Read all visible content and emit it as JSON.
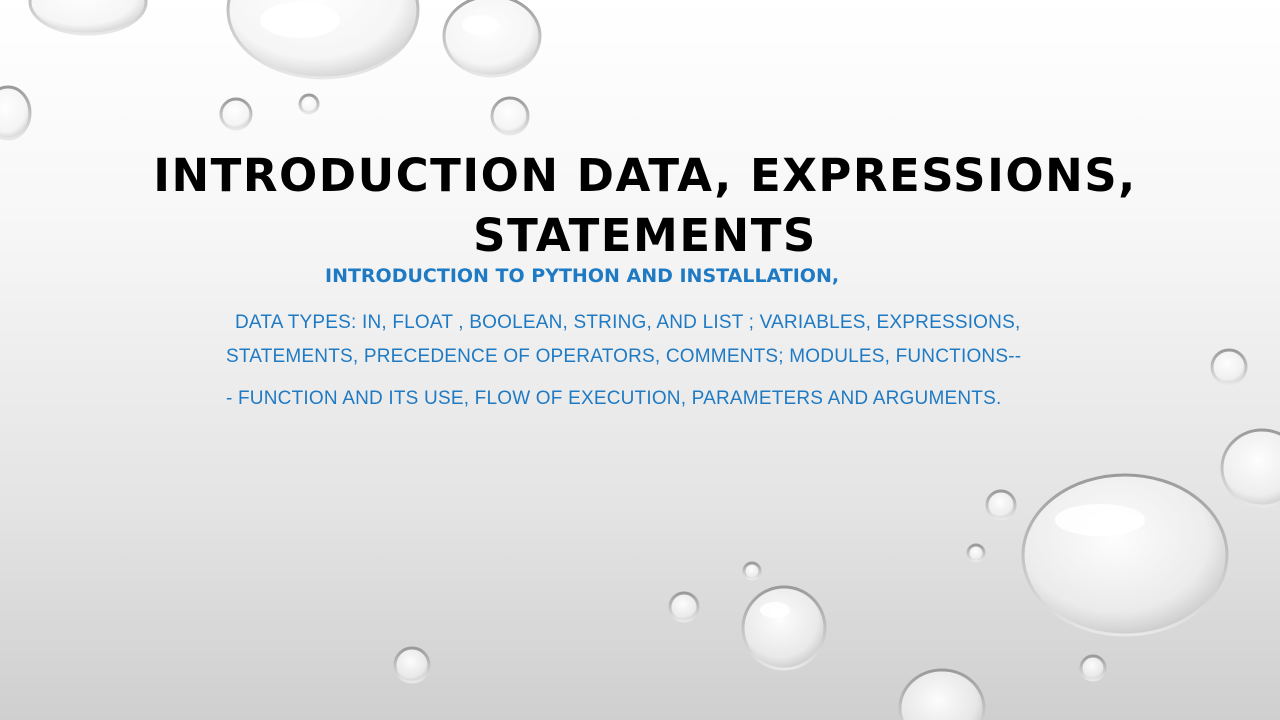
{
  "slide": {
    "title": "Introduction Data, Expressions, Statements",
    "subtitle": "Introduction to Python and installation,",
    "body_lines": [
      "data types: In, float , boolean, string, and list ; variables, expressions,",
      "statements, precedence of operators, comments; modules, functions--",
      "- function and its use, flow of execution, parameters and arguments."
    ]
  },
  "colors": {
    "title": "#000000",
    "body_text": "#1f7ac4",
    "background_top": "#ffffff",
    "background_bottom": "#cfcfcf"
  }
}
